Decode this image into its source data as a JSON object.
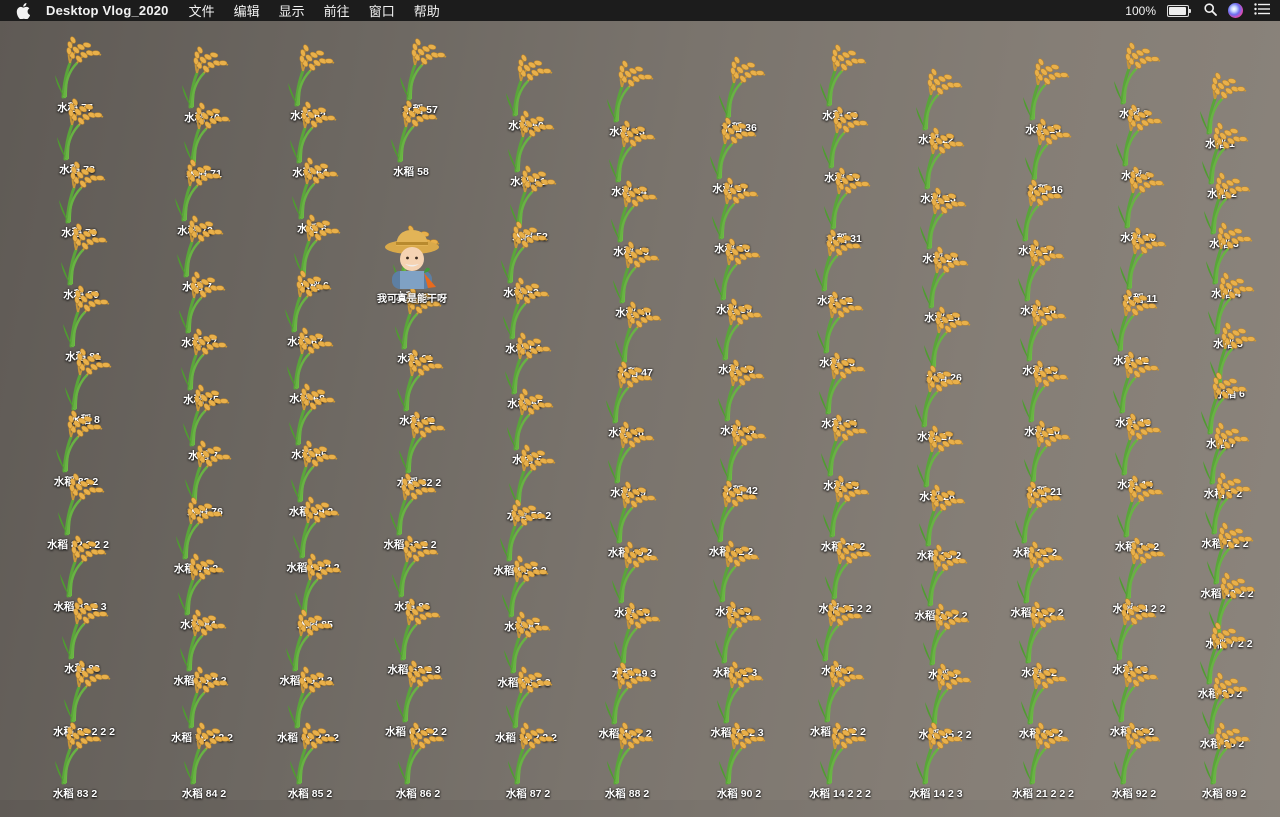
{
  "menubar": {
    "apple_icon": "apple-logo-icon",
    "app_name": "Desktop Vlog_2020",
    "menus": [
      "文件",
      "编辑",
      "显示",
      "前往",
      "窗口",
      "帮助"
    ],
    "battery_percent": "100%",
    "battery_level": 1.0,
    "status_icons": [
      "battery-icon",
      "spotlight-search-icon",
      "siri-icon",
      "control-center-icon"
    ]
  },
  "desktop": {
    "icon_glyph": "rice-plant-icon",
    "farmer": {
      "glyph": "farmer-icon",
      "label": "我可真是能干呀"
    },
    "columns": [
      [
        "水稻 77",
        "水稻 78",
        "水稻 79",
        "水稻 80",
        "水稻 81",
        "水稻 8",
        "水稻 82 2",
        "水稻 82 2 2 2",
        "水稻 82 2 3",
        "水稻 83",
        "水稻 82 2 2 2",
        "水稻 83 2"
      ],
      [
        "水稻 70",
        "水稻 71",
        "水稻 72",
        "水稻 7",
        "水稻 77",
        "水稻 75",
        "水稻 7",
        "水稻 76",
        "水稻 76 2",
        "水稻 84",
        "水稻 76 2 3",
        "水稻 76 2 2 2",
        "水稻 84 2"
      ],
      [
        "水稻 63",
        "水稻 64",
        "水稻 6",
        "水稻 6",
        "水稻 67",
        "水稻 68",
        "水稻 65",
        "水稻 69 2",
        "水稻 69 2 2",
        "水稻 85",
        "水稻 69 2 3",
        "水稻 69 2 2 2",
        "水稻 85 2"
      ],
      [
        "水稻 57",
        "水稻 58",
        "水稻 60",
        "水稻 61",
        "水稻 62",
        "水稻 62 2",
        "水稻 62 2 2",
        "水稻 86",
        "水稻 62 2 3",
        "水稻 62 2 2 2",
        "水稻 86 2"
      ],
      [
        "水稻 50",
        "水稻 51",
        "水稻 52",
        "水稻 53",
        "水稻 54",
        "水稻 55",
        "水稻 5",
        "水稻 56 2",
        "水稻 56 2 2",
        "水稻 87",
        "水稻 56 2 3",
        "水稻 56 2 2 2",
        "水稻 87 2"
      ],
      [
        "水稻 43",
        "水稻 44",
        "水稻 45",
        "水稻 46",
        "水稻 47",
        "水稻 48",
        "水稻 49",
        "水稻 49 2",
        "水稻 88",
        "水稻 49 3",
        "水稻 49 2 2",
        "水稻 88 2"
      ],
      [
        "水稻 36",
        "水稻 37",
        "水稻 38",
        "水稻 39",
        "水稻 40",
        "水稻 41",
        "水稻 42",
        "水稻 42 2",
        "水稻 89",
        "水稻 42 3",
        "水稻 72 2 3",
        "水稻 90 2"
      ],
      [
        "水稻 29",
        "水稻 30",
        "水稻 31",
        "水稻 32",
        "水稻 33",
        "水稻 34",
        "水稻 35",
        "水稻 35 2",
        "水稻 35 2 2",
        "水稻 8",
        "水稻 7 2 2 2",
        "水稻 14 2 2 2"
      ],
      [
        "水稻 22",
        "水稻 23",
        "水稻 24",
        "水稻 25",
        "水稻 26",
        "水稻 27",
        "水稻 28",
        "水稻 28 2",
        "水稻 28 2 2",
        "水稻 9",
        "水稻 35 2 2",
        "水稻 14 2 3"
      ],
      [
        "水稻 15",
        "水稻 16",
        "水稻 17",
        "水稻 18",
        "水稻 19",
        "水稻 20",
        "水稻 21",
        "水稻 21 2",
        "水稻 21 2 2",
        "水稻 92",
        "水稻 93 2",
        "水稻 21 2 2 2"
      ],
      [
        "水稻 8",
        "水稻 9",
        "水稻 10",
        "水稻 11",
        "水稻 12",
        "水稻 13",
        "水稻 14",
        "水稻 14 2",
        "水稻 14 2 2",
        "水稻 93",
        "水稻 91 2",
        "水稻 92 2"
      ],
      [
        "水稻 1",
        "水稻 2",
        "水稻 3",
        "水稻 4",
        "水稻 5",
        "水稻 6",
        "水稻 7",
        "水稻 7 2",
        "水稻 7 2 2",
        "水稻 42 2 2",
        "水稻 7 2 2",
        "水稻 35 2",
        "水稻 28 2",
        "水稻 89 2"
      ]
    ]
  }
}
